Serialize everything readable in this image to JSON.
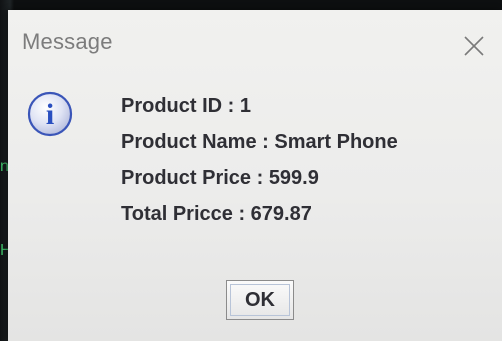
{
  "dialog": {
    "title": "Message",
    "close_icon": "close-icon",
    "info_icon": "info-icon",
    "info_glyph": "i",
    "lines": [
      "Product ID : 1",
      "Product Name : Smart Phone",
      "Product Price : 599.9",
      "Total Pricce : 679.87"
    ],
    "ok_label": "OK"
  },
  "colors": {
    "dialog_background": "#ececeb",
    "text": "#2f2f35",
    "title_text": "#7c7c7c",
    "icon_blue": "#2a4fc0",
    "backdrop_accent": "#3fbf6a"
  }
}
